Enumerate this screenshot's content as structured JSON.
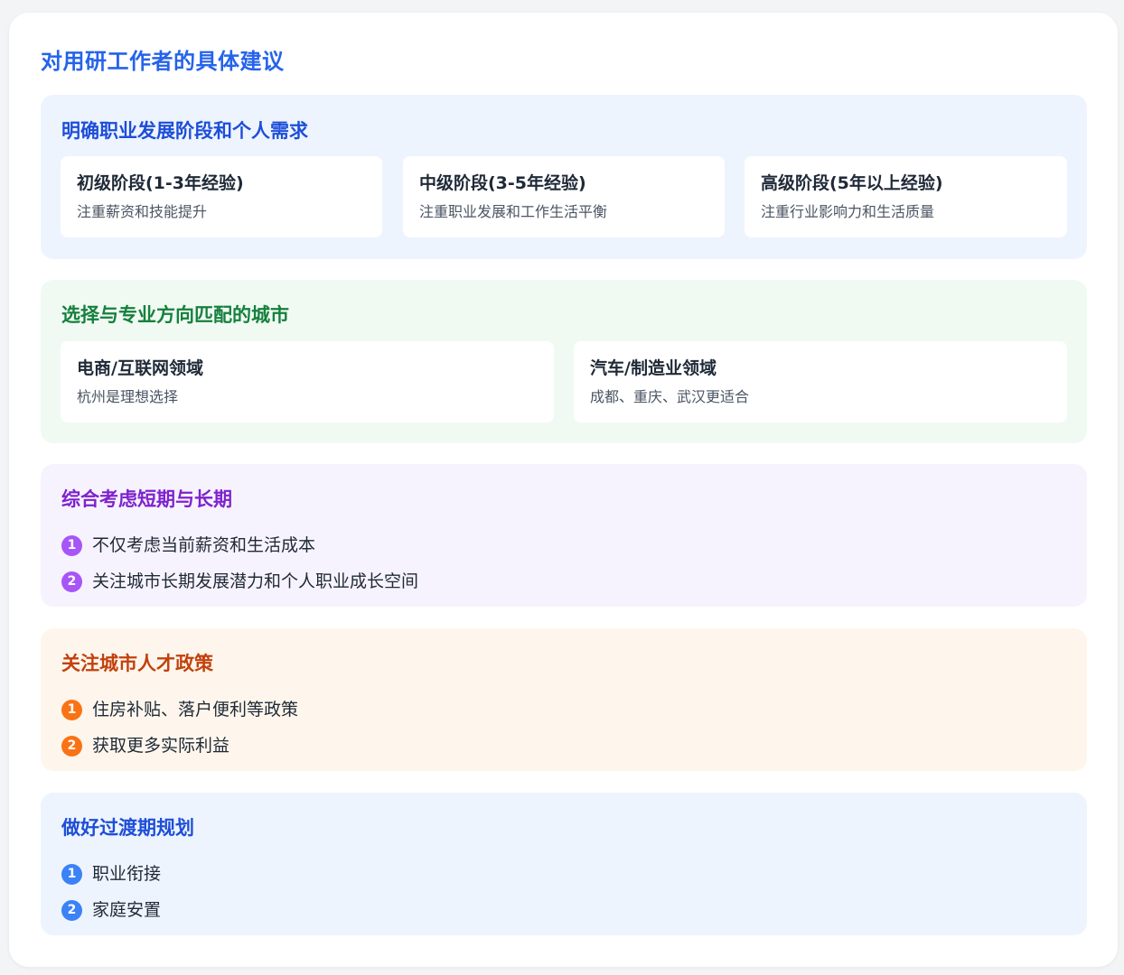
{
  "page": {
    "title": "对用研工作者的具体建议"
  },
  "sections": {
    "stage": {
      "title": "明确职业发展阶段和个人需求",
      "cards": [
        {
          "title": "初级阶段(1-3年经验)",
          "desc": "注重薪资和技能提升"
        },
        {
          "title": "中级阶段(3-5年经验)",
          "desc": "注重职业发展和工作生活平衡"
        },
        {
          "title": "高级阶段(5年以上经验)",
          "desc": "注重行业影响力和生活质量"
        }
      ]
    },
    "city": {
      "title": "选择与专业方向匹配的城市",
      "cards": [
        {
          "title": "电商/互联网领域",
          "desc": "杭州是理想选择"
        },
        {
          "title": "汽车/制造业领域",
          "desc": "成都、重庆、武汉更适合"
        }
      ]
    },
    "term": {
      "title": "综合考虑短期与长期",
      "items": [
        {
          "num": "1",
          "text": "不仅考虑当前薪资和生活成本"
        },
        {
          "num": "2",
          "text": "关注城市长期发展潜力和个人职业成长空间"
        }
      ]
    },
    "policy": {
      "title": "关注城市人才政策",
      "items": [
        {
          "num": "1",
          "text": "住房补贴、落户便利等政策"
        },
        {
          "num": "2",
          "text": "获取更多实际利益"
        }
      ]
    },
    "transition": {
      "title": "做好过渡期规划",
      "items": [
        {
          "num": "1",
          "text": "职业衔接"
        },
        {
          "num": "2",
          "text": "家庭安置"
        }
      ]
    }
  },
  "colors": {
    "title_blue": "#2563eb",
    "stage_accent": "#1d4ed8",
    "city_accent": "#15803d",
    "term_accent": "#7e22ce",
    "policy_accent": "#c2410c",
    "transition_accent": "#1d4ed8"
  }
}
